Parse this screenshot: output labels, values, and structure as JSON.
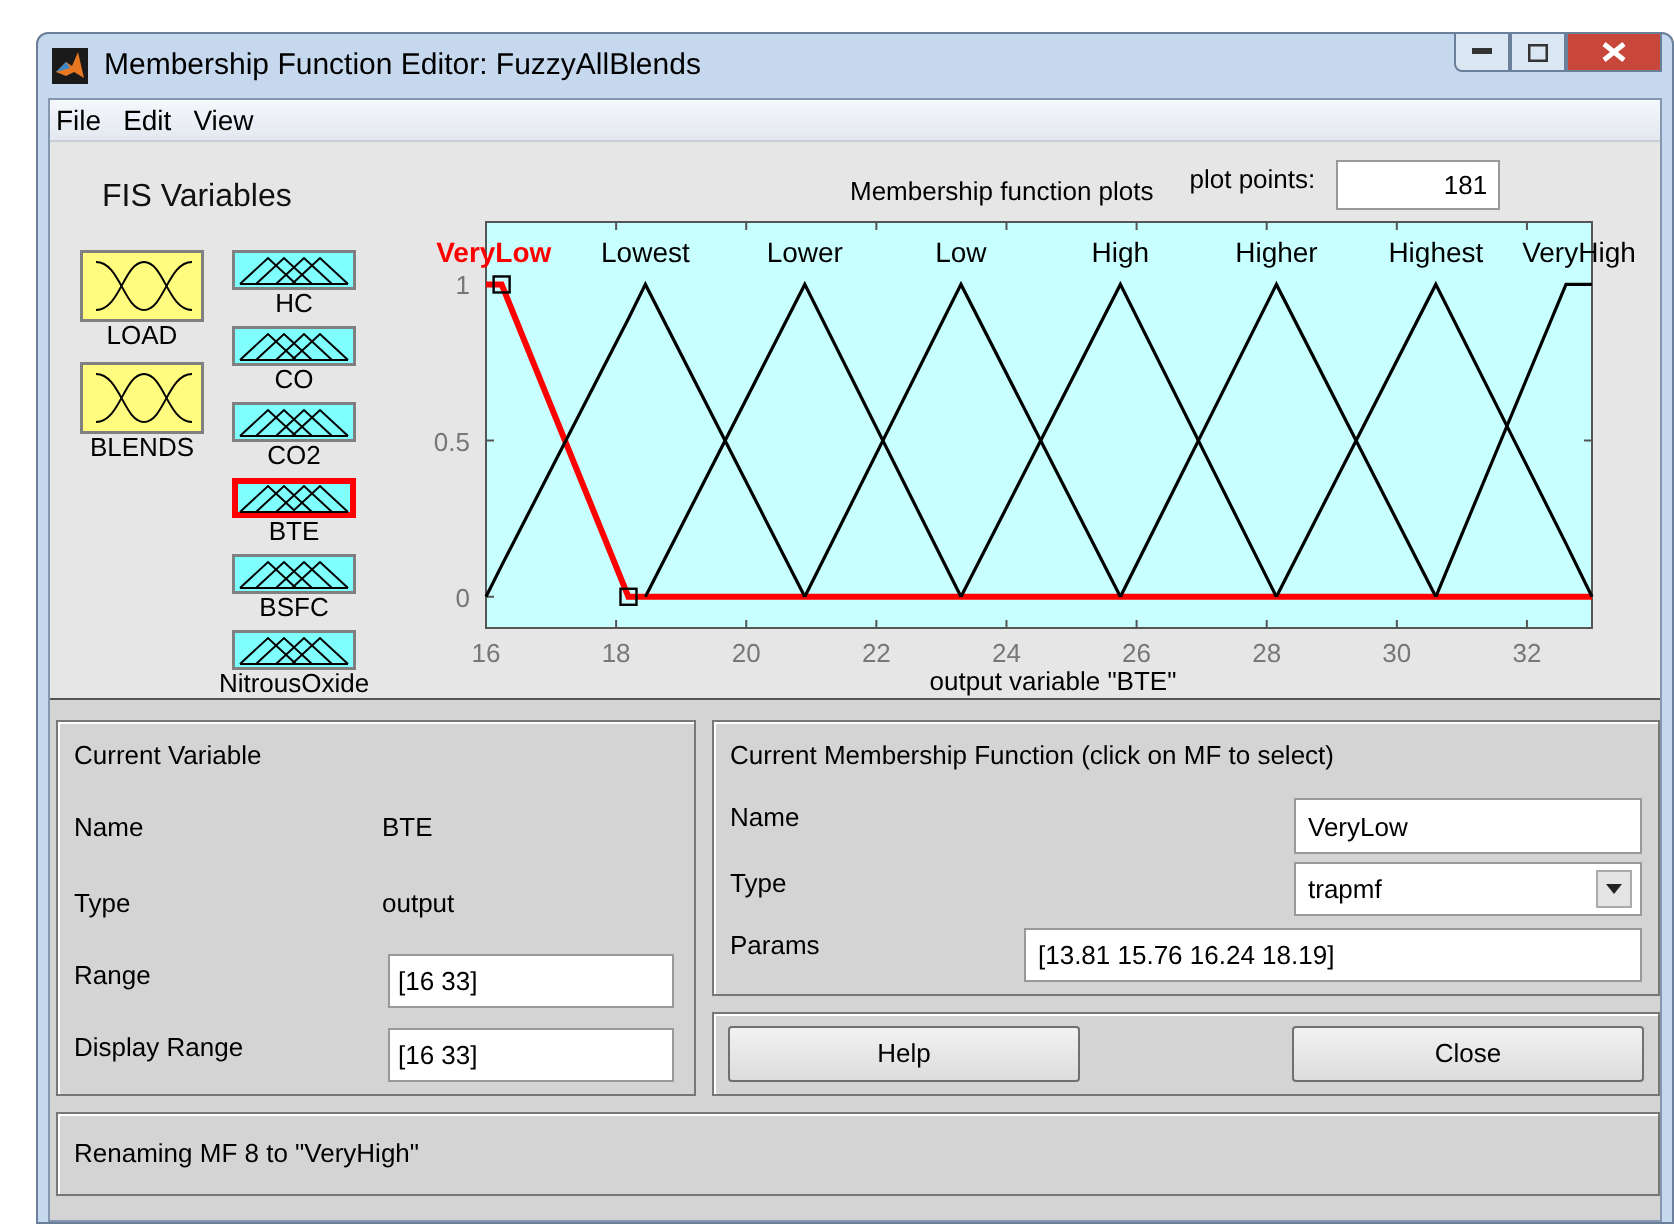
{
  "window": {
    "title": "Membership Function Editor: FuzzyAllBlends"
  },
  "menu": [
    "File",
    "Edit",
    "View"
  ],
  "fis_variables": {
    "title": "FIS Variables",
    "inputs": [
      {
        "name": "LOAD",
        "selected": false
      },
      {
        "name": "BLENDS",
        "selected": false
      }
    ],
    "outputs": [
      {
        "name": "HC",
        "selected": false
      },
      {
        "name": "CO",
        "selected": false
      },
      {
        "name": "CO2",
        "selected": false
      },
      {
        "name": "BTE",
        "selected": true
      },
      {
        "name": "BSFC",
        "selected": false
      },
      {
        "name": "NitrousOxide",
        "selected": false
      }
    ]
  },
  "mf_plot": {
    "title": "Membership function plots",
    "mfs": [
      {
        "selected": true
      },
      {
        "selected": false
      },
      {
        "selected": false
      },
      {
        "selected": false
      },
      {
        "selected": false
      },
      {
        "selected": false
      },
      {
        "selected": false
      },
      {
        "selected": false
      }
    ],
    "plot_points_label": "plot points:",
    "plot_points": "181",
    "chart_data": {
      "type": "line",
      "xlabel": "output variable \"BTE\"",
      "x": [
        16,
        16.24,
        18.19,
        18.45,
        20.9,
        23.3,
        25.75,
        28.15,
        30.6,
        32.6,
        33
      ],
      "xlim": [
        16,
        33
      ],
      "ylim": [
        -0.1,
        1.2
      ],
      "xticks": [
        16,
        18,
        20,
        22,
        24,
        26,
        28,
        30,
        32
      ],
      "yticks": [
        0,
        0.5,
        1
      ],
      "series": [
        {
          "name": "VeryLow",
          "color": "#ff0000",
          "values": [
            1,
            1,
            0,
            0,
            0,
            0,
            0,
            0,
            0,
            0,
            0
          ]
        },
        {
          "name": "Lowest",
          "color": "#000000",
          "values": [
            0,
            0.1,
            0.89,
            1,
            0,
            null,
            null,
            null,
            null,
            null,
            null
          ]
        },
        {
          "name": "Lower",
          "color": "#000000",
          "values": [
            null,
            null,
            null,
            0,
            1,
            0,
            null,
            null,
            null,
            null,
            null
          ]
        },
        {
          "name": "Low",
          "color": "#000000",
          "values": [
            null,
            null,
            null,
            null,
            0,
            1,
            0,
            null,
            null,
            null,
            null
          ]
        },
        {
          "name": "High",
          "color": "#000000",
          "values": [
            null,
            null,
            null,
            null,
            null,
            0,
            1,
            0,
            null,
            null,
            null
          ]
        },
        {
          "name": "Higher",
          "color": "#000000",
          "values": [
            null,
            null,
            null,
            null,
            null,
            null,
            0,
            1,
            0,
            null,
            null
          ]
        },
        {
          "name": "Highest",
          "color": "#000000",
          "values": [
            null,
            null,
            null,
            null,
            null,
            null,
            null,
            0,
            1,
            0.17,
            0
          ]
        },
        {
          "name": "VeryHigh",
          "color": "#000000",
          "values": [
            null,
            null,
            null,
            null,
            null,
            null,
            null,
            null,
            0,
            1,
            1
          ]
        }
      ]
    }
  },
  "current_variable": {
    "title": "Current Variable",
    "name_label": "Name",
    "name": "BTE",
    "type_label": "Type",
    "type": "output",
    "range_label": "Range",
    "range": "[16 33]",
    "display_range_label": "Display Range",
    "display_range": "[16 33]"
  },
  "current_mf": {
    "title": "Current Membership Function (click on MF to select)",
    "name_label": "Name",
    "name": "VeryLow",
    "type_label": "Type",
    "type": "trapmf",
    "params_label": "Params",
    "params": "[13.81 15.76 16.24 18.19]"
  },
  "buttons": [
    "Help",
    "Close"
  ],
  "status": "Renaming MF 8 to \"VeryHigh\""
}
